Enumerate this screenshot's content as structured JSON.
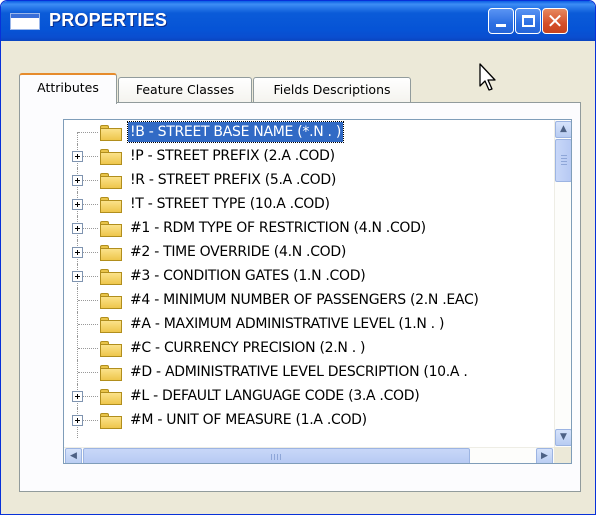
{
  "window": {
    "title": "PROPERTIES"
  },
  "tabs": [
    {
      "label": "Attributes",
      "active": true
    },
    {
      "label": "Feature Classes",
      "active": false
    },
    {
      "label": "Fields Descriptions",
      "active": false
    }
  ],
  "tree": {
    "items": [
      {
        "label": "!B - STREET BASE NAME (*.N .  )",
        "expandable": false,
        "selected": true
      },
      {
        "label": "!P - STREET PREFIX (2.A .COD)",
        "expandable": true,
        "selected": false
      },
      {
        "label": "!R - STREET PREFIX (5.A .COD)",
        "expandable": true,
        "selected": false
      },
      {
        "label": "!T - STREET TYPE (10.A .COD)",
        "expandable": true,
        "selected": false
      },
      {
        "label": "#1 - RDM TYPE OF RESTRICTION (4.N .COD)",
        "expandable": true,
        "selected": false
      },
      {
        "label": "#2 - TIME OVERRIDE (4.N .COD)",
        "expandable": true,
        "selected": false
      },
      {
        "label": "#3 - CONDITION GATES (1.N .COD)",
        "expandable": true,
        "selected": false
      },
      {
        "label": "#4 - MINIMUM NUMBER OF PASSENGERS (2.N .EAC)",
        "expandable": false,
        "selected": false
      },
      {
        "label": "#A - MAXIMUM ADMINISTRATIVE LEVEL (1.N .  )",
        "expandable": false,
        "selected": false
      },
      {
        "label": "#C - CURRENCY PRECISION (2.N .  )",
        "expandable": false,
        "selected": false
      },
      {
        "label": "#D - ADMINISTRATIVE LEVEL DESCRIPTION (10.A .",
        "expandable": false,
        "selected": false
      },
      {
        "label": "#L - DEFAULT LANGUAGE CODE (3.A .COD)",
        "expandable": true,
        "selected": false
      },
      {
        "label": "#M - UNIT OF MEASURE (1.A .COD)",
        "expandable": true,
        "selected": false
      }
    ]
  },
  "scrollbars": {
    "up_glyph": "▲",
    "down_glyph": "▼",
    "left_glyph": "◀",
    "right_glyph": "▶"
  },
  "titlebar_buttons": {
    "close_glyph": "✕"
  },
  "colors": {
    "titlebar": "#0654d6",
    "selection": "#316ac5",
    "window_bg": "#ece9d8"
  },
  "icons": {
    "window": "window-app-icon",
    "folder": "folder-icon",
    "expander": "plus-expander-icon",
    "cursor": "mouse-pointer-icon"
  }
}
